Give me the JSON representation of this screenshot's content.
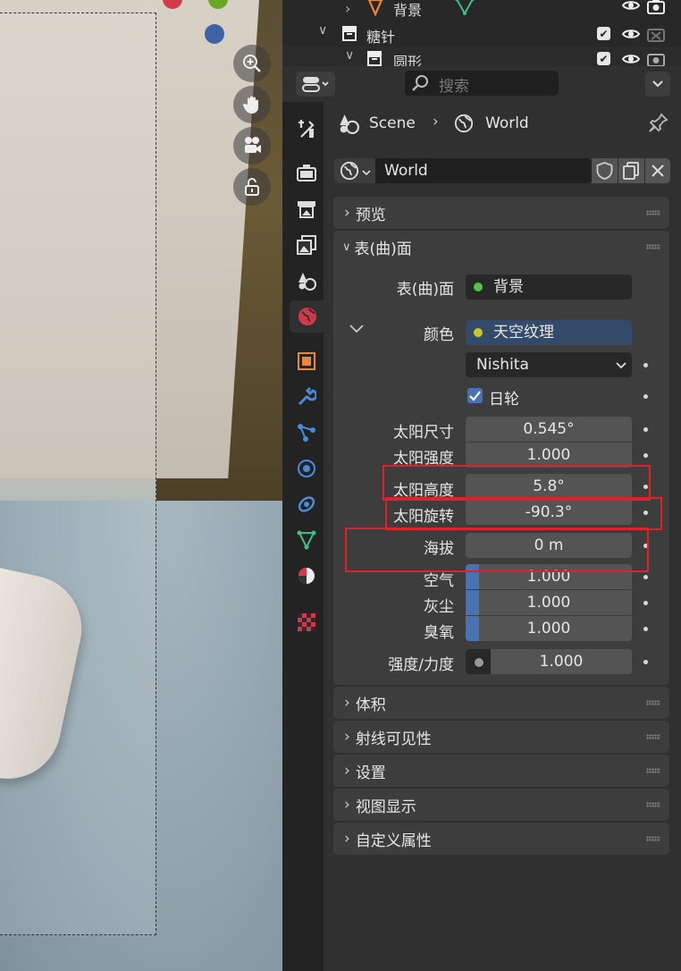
{
  "outliner": {
    "rows": [
      {
        "label": "背景",
        "indent": 1
      },
      {
        "label": "糖针",
        "indent": 0
      },
      {
        "label": "圆形",
        "indent": 1
      }
    ]
  },
  "header": {
    "search_placeholder": "搜索"
  },
  "breadcrumb": {
    "scene": "Scene",
    "world": "World"
  },
  "world_selector": {
    "name": "World"
  },
  "panels": {
    "preview": "预览",
    "surface": "表(曲)面",
    "volume": "体积",
    "ray_visibility": "射线可见性",
    "settings": "设置",
    "viewport_display": "视图显示",
    "custom_props": "自定义属性"
  },
  "surface": {
    "surface_label": "表(曲)面",
    "surface_value": "背景",
    "color_label": "颜色",
    "color_value": "天空纹理",
    "sky_type": "Nishita",
    "sun_disc_label": "日轮",
    "sun_size_label": "太阳尺寸",
    "sun_size": "0.545°",
    "sun_intensity_label": "太阳强度",
    "sun_intensity": "1.000",
    "sun_elevation_label": "太阳高度",
    "sun_elevation": "5.8°",
    "sun_rotation_label": "太阳旋转",
    "sun_rotation": "-90.3°",
    "altitude_label": "海拔",
    "altitude": "0 m",
    "air_label": "空气",
    "air": "1.000",
    "dust_label": "灰尘",
    "dust": "1.000",
    "ozone_label": "臭氧",
    "ozone": "1.000",
    "strength_label": "强度/力度",
    "strength": "1.000"
  },
  "colors": {
    "accent": "#4772b3",
    "highlight": "#e0202a",
    "green_socket": "#4fc24f",
    "yellow_socket": "#c7c729"
  }
}
